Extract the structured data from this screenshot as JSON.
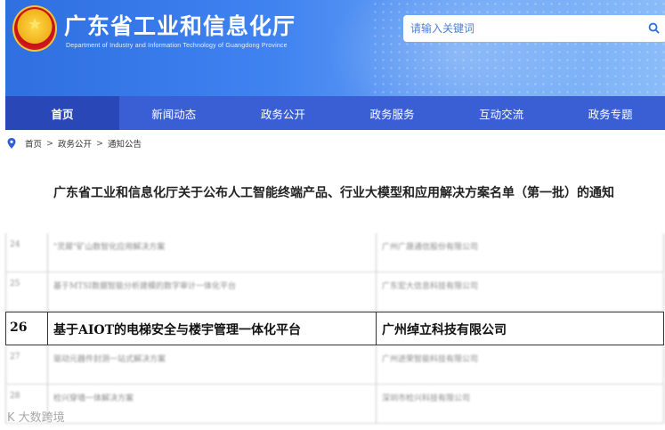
{
  "header": {
    "site_title": "广东省工业和信息化厅",
    "site_subtitle": "Department of Industry and Information Technology of Guangdong Province",
    "search_placeholder": "请输入关键词"
  },
  "nav": {
    "items": [
      {
        "label": "首页"
      },
      {
        "label": "新闻动态"
      },
      {
        "label": "政务公开"
      },
      {
        "label": "政务服务"
      },
      {
        "label": "互动交流"
      },
      {
        "label": "政务专题"
      }
    ]
  },
  "breadcrumb": {
    "items": [
      "首页",
      "政务公开",
      "通知公告"
    ],
    "separator": ">"
  },
  "article": {
    "title": "广东省工业和信息化厅关于公布人工智能终端产品、行业大模型和应用解决方案名单（第一批）的通知"
  },
  "table": {
    "rows": [
      {
        "no": "24",
        "name": "\"灵犀\"矿山数智化应用解决方案",
        "company": "广州广晟通信股份有限公司",
        "blurred": true
      },
      {
        "no": "25",
        "name": "基于MTSI数据智能分析建模的数字审计一体化平台",
        "company": "广东宏大信息科技有限公司",
        "blurred": true
      },
      {
        "no": "26",
        "name": "基于AIOT的电梯安全与楼宇管理一体化平台",
        "company": "广州绰立科技有限公司",
        "blurred": false
      },
      {
        "no": "27",
        "name": "驱动元器件封测一站式解决方案",
        "company": "广州进荣智能科技有限公司",
        "blurred": true
      },
      {
        "no": "28",
        "name": "检兴穿墙一体解决方案",
        "company": "深圳市检兴科技有限公司",
        "blurred": true
      }
    ]
  },
  "watermark": "K 大数跨境",
  "colors": {
    "nav_bg": "#3a5fd4",
    "nav_active": "#2a47b8",
    "header_start": "#2f6fe0",
    "header_end": "#8bbcf8"
  }
}
